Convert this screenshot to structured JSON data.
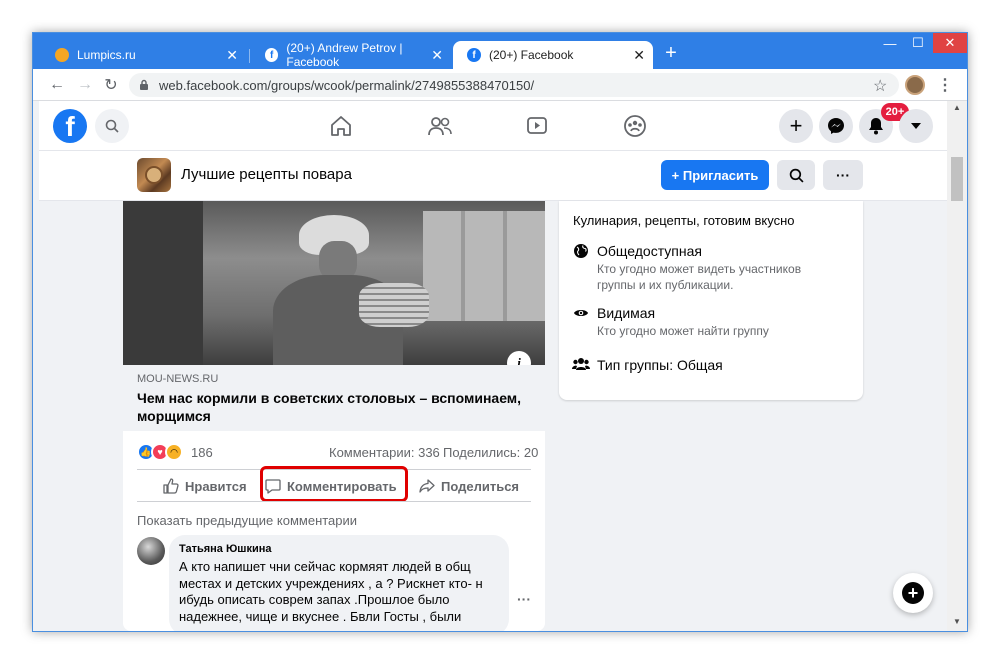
{
  "browser": {
    "tabs": [
      {
        "title": "Lumpics.ru",
        "active": false,
        "favicon": "orange-circle-icon"
      },
      {
        "title": "(20+) Andrew Petrov | Facebook",
        "active": false,
        "favicon": "facebook-icon"
      },
      {
        "title": "(20+) Facebook",
        "active": true,
        "favicon": "facebook-icon"
      }
    ],
    "new_tab": "+",
    "url": "web.facebook.com/groups/wcook/permalink/2749855388470150/",
    "accent_color": "#2f7fe6"
  },
  "header": {
    "notification_badge": "20+",
    "brand_color": "#1877f2"
  },
  "group": {
    "name": "Лучшие рецепты повара",
    "invite_label": "+ Пригласить",
    "more_label": "···"
  },
  "post": {
    "source": "MOU-NEWS.RU",
    "title": "Чем нас кормили в советских столовых – вспоминаем, морщимся",
    "reactions_count": "186",
    "comments_count": "Комментарии: 336",
    "shares_count": "Поделились: 20",
    "actions": {
      "like": "Нравится",
      "comment": "Комментировать",
      "share": "Поделиться"
    },
    "show_previous": "Показать предыдущие комментарии",
    "comment": {
      "author": "Татьяна Юшкина",
      "lines": [
        "А кто напишет чни сейчас кормяят людей в общ",
        "местах и детских учреждениях , а ? Рискнет кто- н",
        "ибудь описать соврем запах .Прошлое было",
        "надежнее, чище и вкуснее . Бвли Госты , были"
      ]
    },
    "highlight_color": "#e00000"
  },
  "about": {
    "description": "Кулинария, рецепты, готовим вкусно",
    "items": [
      {
        "icon": "globe-icon",
        "title": "Общедоступная",
        "sub1": "Кто угодно может видеть участников",
        "sub2": "группы и их публикации."
      },
      {
        "icon": "eye-icon",
        "title": "Видимая",
        "sub1": "Кто угодно может найти группу",
        "sub2": ""
      },
      {
        "icon": "people-icon",
        "title": "Тип группы: Общая",
        "sub1": "",
        "sub2": ""
      }
    ]
  }
}
